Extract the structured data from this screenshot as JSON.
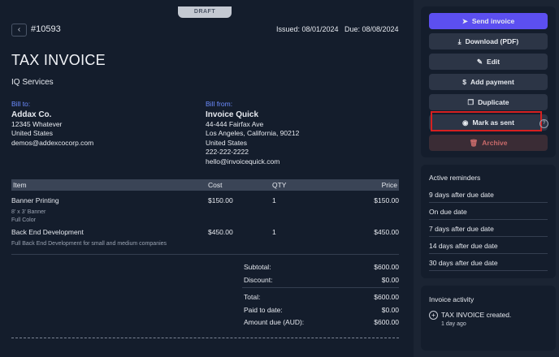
{
  "header": {
    "status_tab": "DRAFT",
    "back_icon": "chevron-left-icon",
    "invoice_number": "#10593",
    "issued": "Issued: 08/01/2024",
    "due": "Due: 08/08/2024"
  },
  "invoice": {
    "title": "TAX INVOICE",
    "company": "IQ Services",
    "bill_to": {
      "label": "Bill to:",
      "name": "Addax Co.",
      "address": "12345 Whatever",
      "country": "United States",
      "email": "demos@addexcocorp.com"
    },
    "bill_from": {
      "label": "Bill from:",
      "name": "Invoice Quick",
      "address": "44-444 Fairfax Ave",
      "city": "Los Angeles, California, 90212",
      "country": "United States",
      "phone": "222-222-2222",
      "email": "hello@invoicequick.com"
    }
  },
  "table": {
    "headers": [
      "Item",
      "Cost",
      "QTY",
      "Price"
    ],
    "rows": [
      {
        "item": "Banner Printing",
        "cost": "$150.00",
        "qty": "1",
        "price": "$150.00",
        "details": [
          "8' x 3' Banner",
          "Full Color"
        ]
      },
      {
        "item": "Back End Development",
        "cost": "$450.00",
        "qty": "1",
        "price": "$450.00",
        "details": [
          "Full Back End Development for small and medium companies"
        ]
      }
    ]
  },
  "totals": {
    "subtotal_label": "Subtotal:",
    "subtotal": "$600.00",
    "discount_label": "Discount:",
    "discount": "$0.00",
    "total_label": "Total:",
    "total": "$600.00",
    "paid_label": "Paid to date:",
    "paid": "$0.00",
    "due_label": "Amount due (AUD):",
    "due": "$600.00"
  },
  "actions": {
    "send": "Send invoice",
    "download": "Download (PDF)",
    "edit": "Edit",
    "add_payment": "Add payment",
    "duplicate": "Duplicate",
    "mark_sent": "Mark as sent",
    "archive": "Archive"
  },
  "reminders": {
    "title": "Active reminders",
    "items": [
      "9 days after due date",
      "On due date",
      "7 days after due date",
      "14 days after due date",
      "30 days after due date"
    ]
  },
  "activity": {
    "title": "Invoice activity",
    "entry": "TAX INVOICE created.",
    "time": "1 day ago"
  },
  "colors": {
    "primary": "#5c4ff0",
    "panel": "#141d2c",
    "background": "#1b2433",
    "archive_text": "#c96a6a",
    "highlight": "#d62020",
    "bill_label": "#6c8cff"
  }
}
